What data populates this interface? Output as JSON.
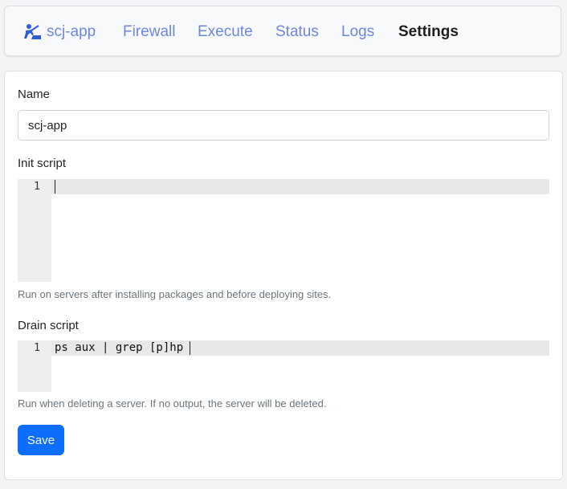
{
  "nav": {
    "brand": "scj-app",
    "items": [
      "Firewall",
      "Execute",
      "Status",
      "Logs"
    ],
    "active": "Settings",
    "accent_color": "#6f86e0"
  },
  "form": {
    "name_label": "Name",
    "name_value": "scj-app",
    "init_label": "Init script",
    "init_line_number": "1",
    "init_code": "",
    "init_help": "Run on servers after installing packages and before deploying sites.",
    "drain_label": "Drain script",
    "drain_line_number": "1",
    "drain_code": "ps aux | grep [p]hp",
    "drain_help": "Run when deleting a server. If no output, the server will be deleted.",
    "save_label": "Save",
    "save_color": "#0d6efd"
  }
}
